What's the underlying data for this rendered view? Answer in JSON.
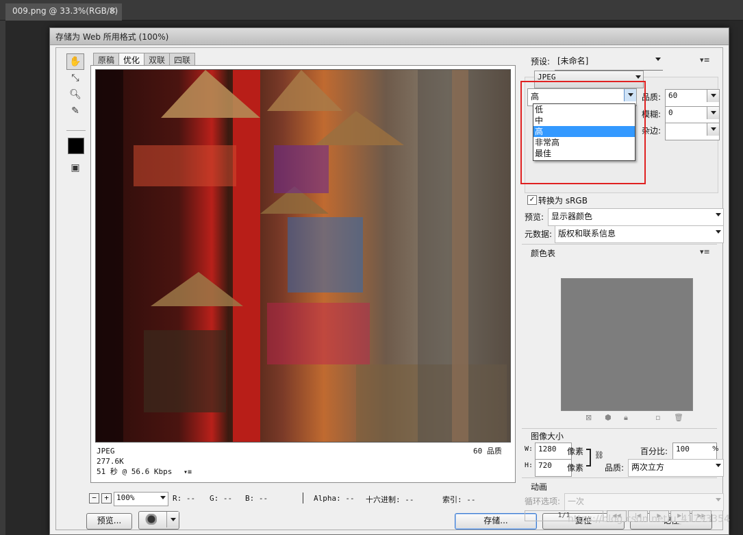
{
  "document_tab": {
    "title": "009.png @ 33.3%(RGB/8)",
    "close": "×"
  },
  "dialog": {
    "title": "存储为 Web 所用格式 (100%)"
  },
  "view_tabs": [
    "原稿",
    "优化",
    "双联",
    "四联"
  ],
  "preview_info": {
    "format": "JPEG",
    "size": "277.6K",
    "time": "51 秒 @ 56.6 Kbps",
    "quality_label": "60 品质",
    "menu": "▾≡"
  },
  "statusbar": {
    "zoom_minus": "−",
    "zoom_plus": "+",
    "zoom": "100%",
    "r": "R: --",
    "g": "G: --",
    "b": "B: --",
    "alpha": "Alpha: --",
    "hex": "十六进制: --",
    "index": "索引: --"
  },
  "buttons": {
    "preview": "预览...",
    "save": "存储...",
    "reset": "复位",
    "remember": "记住",
    "browser_icon": "help-browser-icon"
  },
  "settings": {
    "preset_label": "预设:",
    "preset_value": "[未命名]",
    "format": "JPEG",
    "quality_level": "高",
    "quality_options": [
      "低",
      "中",
      "高",
      "非常高",
      "最佳"
    ],
    "quality_label": "品质:",
    "quality_value": "60",
    "blur_label": "模糊:",
    "blur_value": "0",
    "matte_label": "杂边:",
    "matte_value": "",
    "convert_srgb_label": "转换为 sRGB",
    "convert_srgb_checked": "✓",
    "preview_label": "预览:",
    "preview_value": "显示器颜色",
    "metadata_label": "元数据:",
    "metadata_value": "版权和联系信息"
  },
  "color_table": {
    "title": "颜色表"
  },
  "image_size": {
    "title": "图像大小",
    "w_label": "W:",
    "w_value": "1280",
    "h_label": "H:",
    "h_value": "720",
    "unit": "像素",
    "percent_label": "百分比:",
    "percent_value": "100",
    "percent_unit": "%",
    "quality_label": "品质:",
    "quality_value": "两次立方"
  },
  "animation": {
    "title": "动画",
    "loop_label": "循环选项:",
    "loop_value": "一次",
    "frame_counter": "1/1"
  },
  "watermark": "https://blog.csdn.net/u_41793354",
  "colors": {
    "highlight": "#3399ff",
    "annotation_red": "#e02020"
  }
}
